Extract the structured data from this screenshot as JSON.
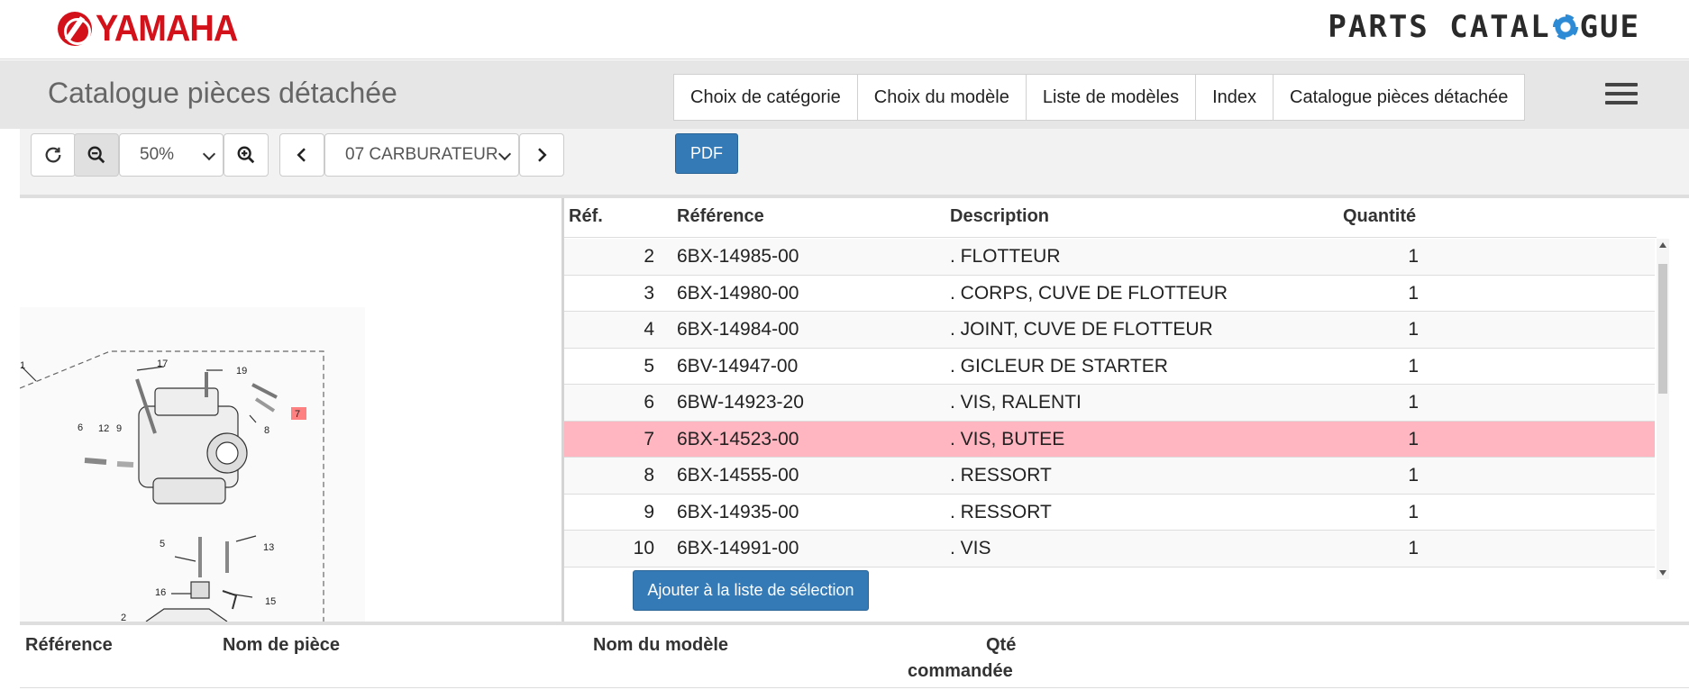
{
  "brand": {
    "logo_text": "YAMAHA",
    "catalogue_logo_left": "PARTS CATAL",
    "catalogue_logo_right": "GUE",
    "accent_color": "#d2111a",
    "button_color": "#337ab7"
  },
  "header": {
    "title": "Catalogue pièces détachée",
    "nav": [
      "Choix de catégorie",
      "Choix du modèle",
      "Liste de modèles",
      "Index",
      "Catalogue pièces détachée"
    ]
  },
  "toolbar": {
    "zoom_value": "50%",
    "section_value": "07 CARBURATEUR",
    "pdf_label": "PDF"
  },
  "diagram": {
    "callouts": [
      "1",
      "17",
      "19",
      "7",
      "6",
      "12",
      "9",
      "8",
      "5",
      "13",
      "16",
      "15",
      "2"
    ],
    "highlighted_callout": "7"
  },
  "parts_table": {
    "headers": {
      "ref": "Réf.",
      "part": "Référence",
      "desc": "Description",
      "qty": "Quantité"
    },
    "rows": [
      {
        "ref": "2",
        "part": "6BX-14985-00",
        "desc": ". FLOTTEUR",
        "qty": "1"
      },
      {
        "ref": "3",
        "part": "6BX-14980-00",
        "desc": ". CORPS, CUVE DE FLOTTEUR",
        "qty": "1"
      },
      {
        "ref": "4",
        "part": "6BX-14984-00",
        "desc": ". JOINT, CUVE DE FLOTTEUR",
        "qty": "1"
      },
      {
        "ref": "5",
        "part": "6BV-14947-00",
        "desc": ". GICLEUR DE STARTER",
        "qty": "1"
      },
      {
        "ref": "6",
        "part": "6BW-14923-20",
        "desc": ". VIS, RALENTI",
        "qty": "1"
      },
      {
        "ref": "7",
        "part": "6BX-14523-00",
        "desc": ". VIS, BUTEE",
        "qty": "1"
      },
      {
        "ref": "8",
        "part": "6BX-14555-00",
        "desc": ". RESSORT",
        "qty": "1"
      },
      {
        "ref": "9",
        "part": "6BX-14935-00",
        "desc": ". RESSORT",
        "qty": "1"
      },
      {
        "ref": "10",
        "part": "6BX-14991-00",
        "desc": ". VIS",
        "qty": "1"
      }
    ],
    "selected_ref": "7",
    "add_button_label": "Ajouter à la liste de sélection"
  },
  "selection_list": {
    "headers": {
      "part": "Référence",
      "name": "Nom de pièce",
      "model": "Nom du modèle",
      "qty_line1": "Qté",
      "qty_line2": "commandée"
    }
  }
}
